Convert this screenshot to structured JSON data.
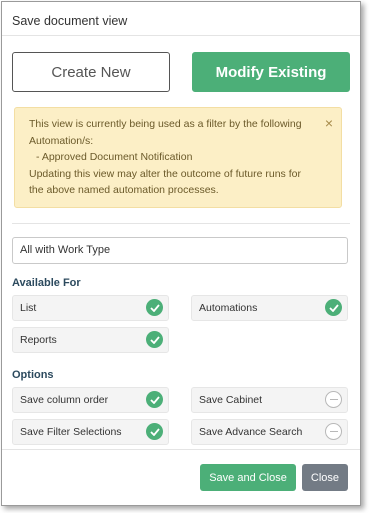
{
  "dialog": {
    "title": "Save document view",
    "create_new_label": "Create New",
    "modify_existing_label": "Modify Existing",
    "close_alert_glyph": "×"
  },
  "alert": {
    "line1": "This view is currently being used as a filter by the following Automation/s:",
    "automation_item": "- Approved Document Notification",
    "line2": "Updating this view may alter the outcome of future runs for the above named automation processes."
  },
  "view_name": {
    "value": "All with Work Type"
  },
  "available_for": {
    "title": "Available For",
    "items": [
      {
        "label": "List",
        "state": "checked"
      },
      {
        "label": "Automations",
        "state": "checked"
      },
      {
        "label": "Reports",
        "state": "checked"
      }
    ]
  },
  "options": {
    "title": "Options",
    "items": [
      {
        "label": "Save column order",
        "state": "checked"
      },
      {
        "label": "Save Cabinet",
        "state": "unchecked"
      },
      {
        "label": "Save Filter Selections",
        "state": "checked"
      },
      {
        "label": "Save Advance Search",
        "state": "unchecked"
      }
    ]
  },
  "footer": {
    "save_close_label": "Save and Close",
    "close_label": "Close"
  },
  "colors": {
    "accent_green": "#4caf78",
    "alert_bg": "#fcefc6",
    "close_btn": "#737b85"
  },
  "icons": {
    "checked": "check-circle-icon",
    "unchecked": "minus-circle-icon",
    "dismiss": "close-icon"
  }
}
